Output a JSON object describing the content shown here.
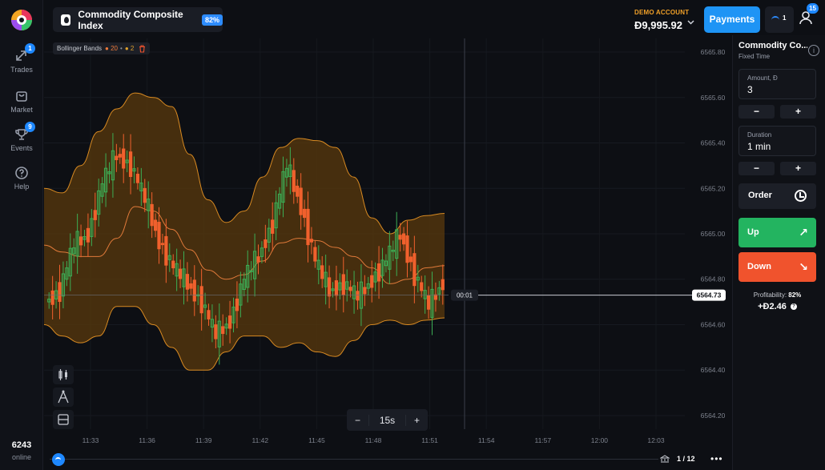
{
  "sidebar": {
    "items": [
      {
        "label": "Trades",
        "icon": "trades-icon",
        "badge": "1"
      },
      {
        "label": "Market",
        "icon": "market-icon",
        "badge": ""
      },
      {
        "label": "Events",
        "icon": "trophy-icon",
        "badge": "9"
      },
      {
        "label": "Help",
        "icon": "help-icon",
        "badge": ""
      }
    ],
    "online_count": "6243",
    "online_label": "online"
  },
  "header": {
    "asset_name": "Commodity Composite Index",
    "asset_payout": "82%",
    "account_label": "DEMO ACCOUNT",
    "balance": "Đ9,995.92",
    "payments_label": "Payments",
    "mini_count": "1",
    "user_badge": "15"
  },
  "indicator": {
    "name": "Bollinger Bands",
    "period": "20",
    "deviation": "2",
    "separator": "•"
  },
  "chart_data": {
    "type": "candlestick",
    "y_ticks": [
      "6565.80",
      "6565.60",
      "6565.40",
      "6565.20",
      "6565.00",
      "6564.80",
      "6564.60",
      "6564.40",
      "6564.20"
    ],
    "ylim": [
      6564.14,
      6565.86
    ],
    "x_ticks": [
      "11:33",
      "11:36",
      "11:39",
      "11:42",
      "11:45",
      "11:48",
      "11:51",
      "11:54",
      "11:57",
      "12:00",
      "12:03"
    ],
    "current_price": "6564.73",
    "current_price_value": 6564.73,
    "countdown": "00:01",
    "colors": {
      "up": "#3cae55",
      "down": "#f0602d",
      "band": "#d88a22",
      "band_fill": "#5a3a0c"
    },
    "bollinger_upper": [
      6565.2,
      6565.18,
      6565.3,
      6565.45,
      6565.55,
      6565.62,
      6565.6,
      6565.56,
      6565.35,
      6565.15,
      6565.05,
      6565.1,
      6565.25,
      6565.38,
      6565.42,
      6565.41,
      6565.38,
      6565.25,
      6565.07,
      6565.0,
      6565.06,
      6565.08,
      6565.09
    ],
    "bollinger_mid": [
      6564.95,
      6564.92,
      6564.9,
      6564.9,
      6564.98,
      6565.12,
      6565.1,
      6565.02,
      6564.93,
      6564.84,
      6564.8,
      6564.82,
      6564.88,
      6564.96,
      6564.98,
      6564.97,
      6564.94,
      6564.9,
      6564.85,
      6564.78,
      6564.8,
      6564.85,
      6564.86
    ],
    "bollinger_lower": [
      6564.6,
      6564.55,
      6564.52,
      6564.55,
      6564.68,
      6564.68,
      6564.6,
      6564.5,
      6564.4,
      6564.4,
      6564.48,
      6564.55,
      6564.55,
      6564.5,
      6564.52,
      6564.48,
      6564.46,
      6564.53,
      6564.6,
      6564.62,
      6564.6,
      6564.62,
      6564.63
    ],
    "candles": [
      [
        6564.7,
        6564.75
      ],
      [
        6564.75,
        6564.95
      ],
      [
        6564.95,
        6565.0
      ],
      [
        6565.0,
        6565.22
      ],
      [
        6565.22,
        6565.35
      ],
      [
        6565.35,
        6565.3
      ],
      [
        6565.3,
        6565.15
      ],
      [
        6565.15,
        6564.97
      ],
      [
        6564.97,
        6564.85
      ],
      [
        6564.85,
        6564.78
      ],
      [
        6564.78,
        6564.7
      ],
      [
        6564.7,
        6564.55
      ],
      [
        6564.55,
        6564.62
      ],
      [
        6564.62,
        6564.8
      ],
      [
        6564.8,
        6564.9
      ],
      [
        6564.9,
        6565.05
      ],
      [
        6565.05,
        6565.3
      ],
      [
        6565.3,
        6565.12
      ],
      [
        6565.12,
        6564.88
      ],
      [
        6564.88,
        6564.75
      ],
      [
        6564.75,
        6564.78
      ],
      [
        6564.78,
        6564.72
      ],
      [
        6564.72,
        6564.8
      ],
      [
        6564.8,
        6564.88
      ],
      [
        6564.88,
        6565.0
      ],
      [
        6565.0,
        6564.82
      ],
      [
        6564.82,
        6564.68
      ],
      [
        6564.68,
        6564.79
      ]
    ]
  },
  "timeframe": {
    "value": "15s",
    "minus": "−",
    "plus": "+"
  },
  "pager": "1 / 12",
  "more": "•••",
  "panel": {
    "title": "Commodity Co...",
    "subtitle": "Fixed Time",
    "amount_label": "Amount, Đ",
    "amount_value": "3",
    "duration_label": "Duration",
    "duration_value": "1 min",
    "minus": "−",
    "plus": "+",
    "order_label": "Order",
    "up_label": "Up",
    "down_label": "Down",
    "up_arrow": "↗",
    "down_arrow": "↘",
    "profitability_label": "Profitability:",
    "profitability_value": "82%",
    "profit_amount": "+Đ2.46",
    "info": "i",
    "help": "?"
  }
}
